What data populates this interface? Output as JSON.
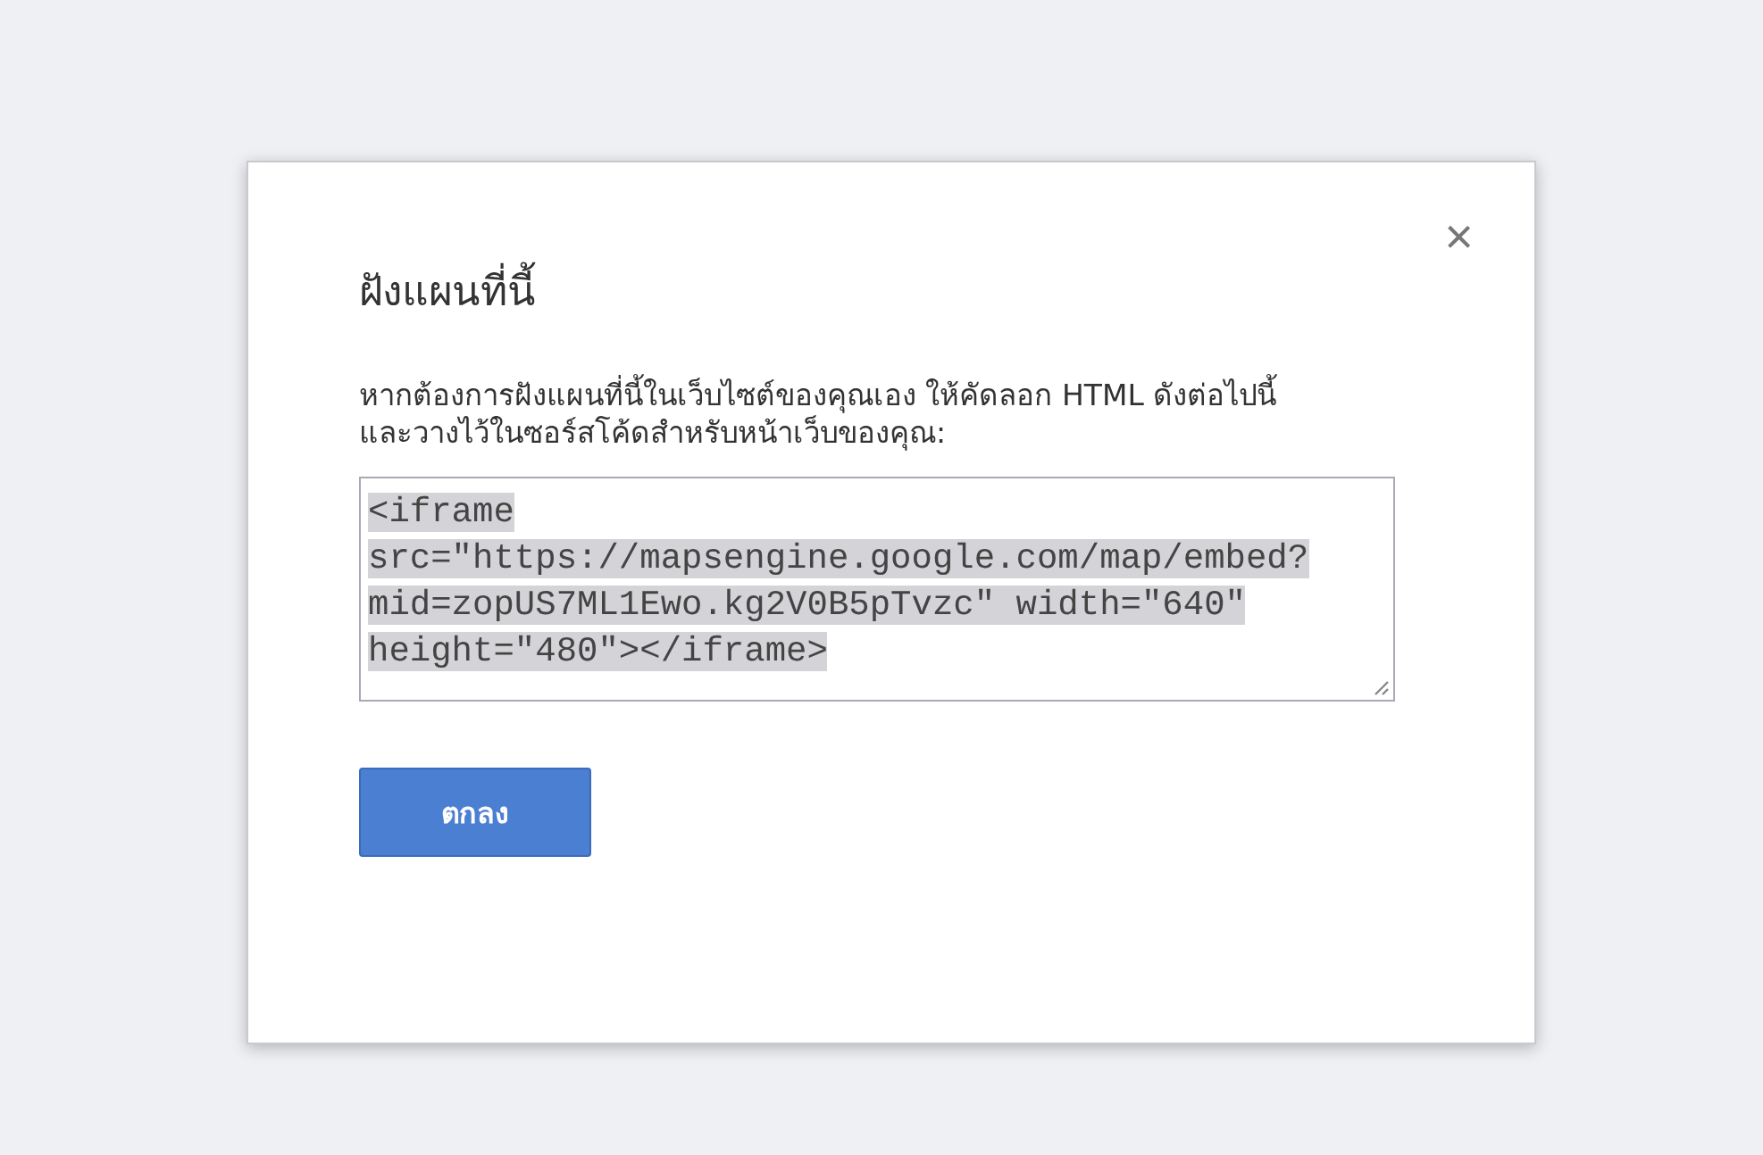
{
  "dialog": {
    "title": "ฝังแผนที่นี้",
    "close": "×",
    "message": "หากต้องการฝังแผนที่นี้ในเว็บไซต์ของคุณเอง ให้คัดลอก HTML ดังต่อไปนี้และวางไว้ในซอร์สโค้ดสำหรับหน้าเว็บของคุณ:",
    "code": {
      "selected": true,
      "lines": [
        "<iframe",
        "src=\"https://mapsengine.google.com/map/embed?",
        "mid=zopUS7ML1Ewo.kg2V0B5pTvzc\" width=\"640\"",
        "height=\"480\"></iframe>"
      ]
    },
    "button": "ตกลง"
  }
}
